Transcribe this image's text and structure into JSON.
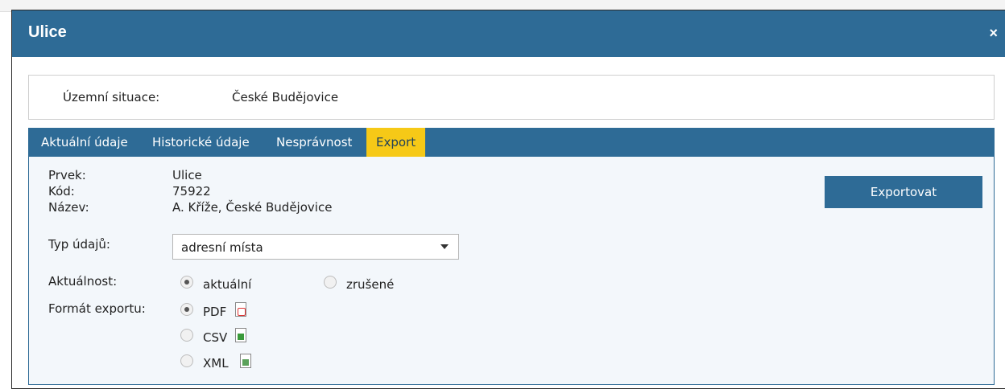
{
  "dialog": {
    "title": "Ulice",
    "close_symbol": "×"
  },
  "situation": {
    "label": "Územní situace:",
    "value": "České Budějovice"
  },
  "tabs": [
    {
      "label": "Aktuální údaje",
      "active": false
    },
    {
      "label": "Historické údaje",
      "active": false
    },
    {
      "label": "Nesprávnost",
      "active": false
    },
    {
      "label": "Export",
      "active": true
    }
  ],
  "details": {
    "prvek_label": "Prvek:",
    "prvek_value": "Ulice",
    "kod_label": "Kód:",
    "kod_value": "75922",
    "nazev_label": "Název:",
    "nazev_value": "A. Kříže, České Budějovice"
  },
  "typ_udaju": {
    "label": "Typ údajů:",
    "selected": "adresní místa"
  },
  "aktualnost": {
    "label": "Aktuálnost:",
    "options": [
      {
        "label": "aktuální",
        "checked": true
      },
      {
        "label": "zrušené",
        "checked": false
      }
    ]
  },
  "format": {
    "label": "Formát exportu:",
    "options": [
      {
        "label": "PDF",
        "checked": true,
        "icon": "pdf-file-icon"
      },
      {
        "label": "CSV",
        "checked": false,
        "icon": "csv-file-icon"
      },
      {
        "label": "XML",
        "checked": false,
        "icon": "xml-file-icon"
      }
    ]
  },
  "export_button": "Exportovat",
  "colors": {
    "accent": "#2e6b96",
    "active_tab": "#f6c917",
    "panel": "#f3f7fb"
  }
}
